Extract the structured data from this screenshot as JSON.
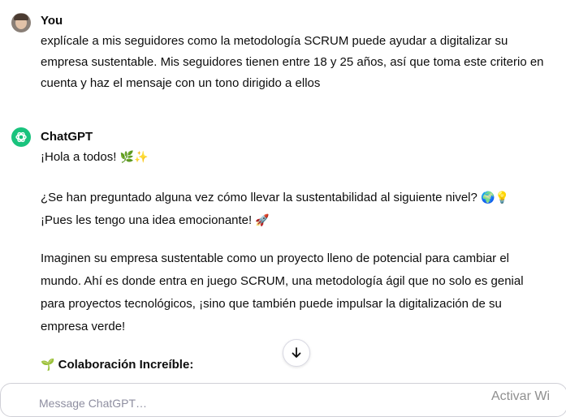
{
  "user_message": {
    "author": "You",
    "text": "explícale a mis seguidores como la metodología SCRUM puede ayudar a digitalizar su empresa sustentable. Mis seguidores tienen entre 18 y 25 años, así que toma este criterio en cuenta y haz el mensaje con un tono dirigido a ellos"
  },
  "assistant_message": {
    "author": "ChatGPT",
    "greeting": "¡Hola a todos!",
    "greeting_emoji": "🌿✨",
    "p1_line1": "¿Se han preguntado alguna vez cómo llevar la sustentabilidad al siguiente nivel?",
    "p1_line1_emoji": "🌍💡",
    "p1_line2": "¡Pues les tengo una idea emocionante!",
    "p1_line2_emoji": "🚀",
    "p2": "Imaginen su empresa sustentable como un proyecto lleno de potencial para cambiar el mundo. Ahí es donde entra en juego SCRUM, una metodología ágil que no solo es genial para proyectos tecnológicos, ¡sino que también puede impulsar la digitalización de su empresa verde!",
    "heading_emoji": "🌱",
    "heading": "Colaboración Increíble:"
  },
  "composer": {
    "placeholder": "Message ChatGPT…"
  },
  "watermark": "Activar Wi",
  "icons": {
    "user_avatar": "avatar-photo",
    "bot_avatar": "openai-logo-icon",
    "scroll_down": "arrow-down-icon"
  },
  "colors": {
    "bot_avatar_bg": "#19c37d"
  }
}
